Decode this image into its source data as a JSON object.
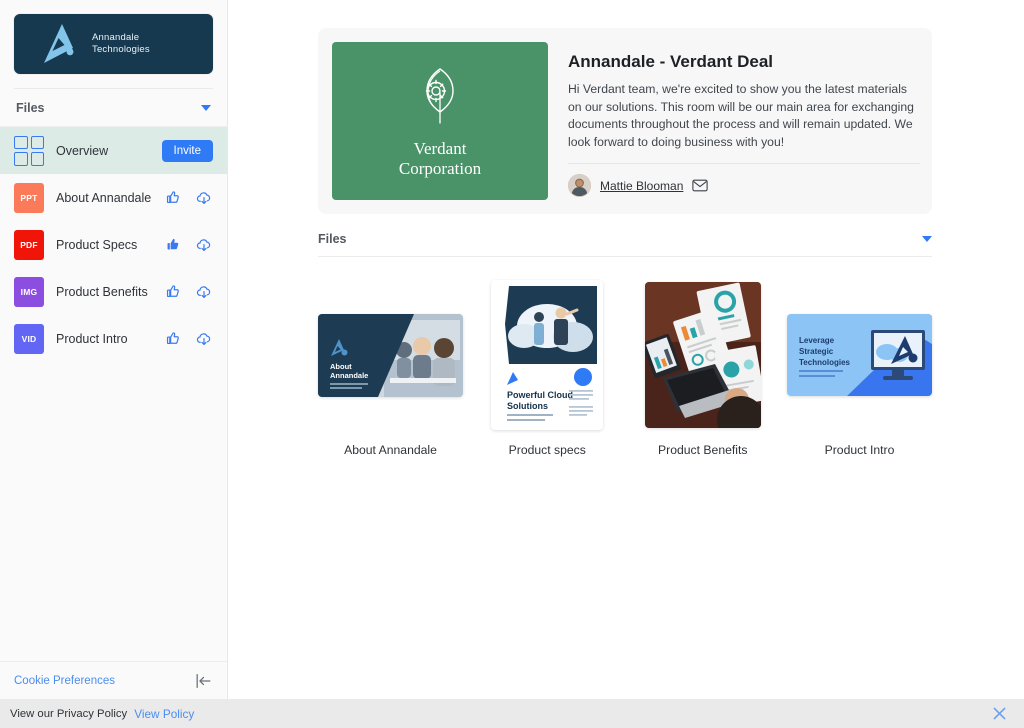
{
  "sidebar": {
    "logo": {
      "company": "Annandale",
      "division": "Technologies",
      "icon": "annandale-a-logo"
    },
    "section_header": {
      "label": "Files",
      "chevron_icon": "triangle-down-icon"
    },
    "overview_row": {
      "label": "Overview",
      "icon": "grid-four-squares-icon",
      "invite_label": "Invite"
    },
    "files": [
      {
        "badge": "PPT",
        "badge_color": "#fa7a5a",
        "name": "About Annandale",
        "liked": false,
        "like_icon": "thumbs-up-outline-icon",
        "download_icon": "cloud-download-icon"
      },
      {
        "badge": "PDF",
        "badge_color": "#f11409",
        "name": "Product Specs",
        "liked": true,
        "like_icon": "thumbs-up-filled-icon",
        "download_icon": "cloud-download-icon"
      },
      {
        "badge": "IMG",
        "badge_color": "#8b4ee0",
        "name": "Product Benefits",
        "liked": false,
        "like_icon": "thumbs-up-outline-icon",
        "download_icon": "cloud-download-icon"
      },
      {
        "badge": "VID",
        "badge_color": "#6366f5",
        "name": "Product Intro",
        "liked": false,
        "like_icon": "thumbs-up-outline-icon",
        "download_icon": "cloud-download-icon"
      }
    ],
    "footer": {
      "cookie_label": "Cookie Preferences",
      "collapse_icon": "collapse-sidebar-left-icon"
    }
  },
  "hero": {
    "client_logo": {
      "line1": "Verdant",
      "line2": "Corporation",
      "icon": "leaf-gear-icon",
      "color": "#4a9369"
    },
    "title": "Annandale - Verdant Deal",
    "description": "Hi Verdant team, we're excited to show you the latest materials on our solutions. This room will be our main area for exchanging documents throughout the process and will remain updated. We look forward to doing business with you!",
    "owner": {
      "name": "Mattie Blooman",
      "avatar_icon": "user-photo-avatar",
      "email_icon": "envelope-icon"
    }
  },
  "files_section": {
    "header": {
      "label": "Files",
      "chevron_icon": "triangle-down-icon"
    },
    "items": [
      {
        "label": "About Annandale",
        "thumb": "about-annandale-slide",
        "slide_title_line1": "About",
        "slide_title_line2": "Annandale",
        "slide_sub": "Creating best-in-class experiences for you and your customers"
      },
      {
        "label": "Product specs",
        "thumb": "powerful-cloud-solutions-doc",
        "doc_title_line1": "Powerful Cloud",
        "doc_title_line2": "Solutions",
        "doc_sub": "How to successfully scale & grow by leveraging the cloud"
      },
      {
        "label": "Product Benefits",
        "thumb": "desk-laptop-reports-photo"
      },
      {
        "label": "Product Intro",
        "thumb": "leverage-strategic-technologies-slide",
        "slide_title_line1": "Leverage",
        "slide_title_line2": "Strategic",
        "slide_title_line3": "Technologies",
        "slide_sub": "Effectively and efficiently use the latest technology for your advantage"
      }
    ]
  },
  "privacy_banner": {
    "text": "View our Privacy Policy",
    "link_label": "View Policy",
    "close_icon": "close-x-icon"
  },
  "colors": {
    "brand_navy": "#17394f",
    "accent_blue": "#2f7af5",
    "client_green": "#4a9369",
    "active_row": "#dcebe5"
  }
}
